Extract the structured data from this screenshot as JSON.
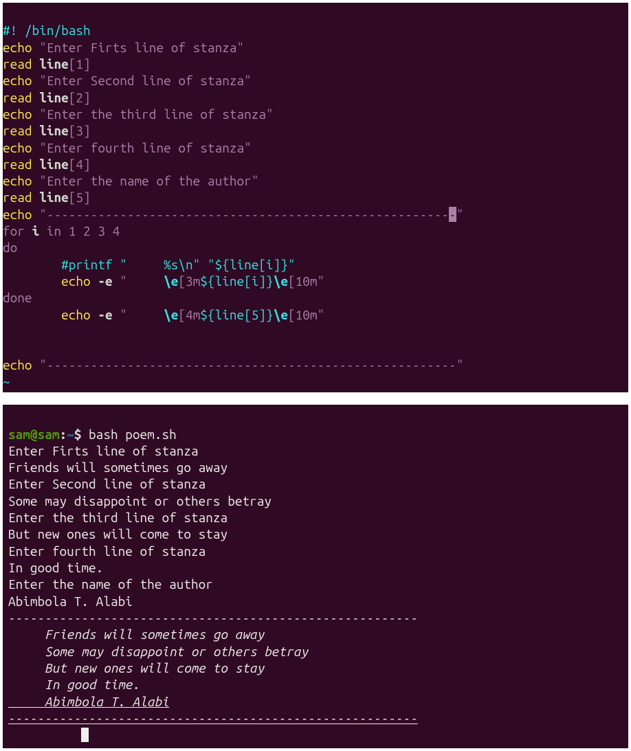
{
  "editor": {
    "l1": {
      "shebang": "#! /bin/bash"
    },
    "l2": {
      "cmd": "echo",
      "str": "\"Enter Firts line of stanza\""
    },
    "l3": {
      "cmd": "read",
      "var": "line",
      "idx": "[1]"
    },
    "l4": {
      "cmd": "echo",
      "str": "\"Enter Second line of stanza\""
    },
    "l5": {
      "cmd": "read",
      "var": "line",
      "idx": "[2]"
    },
    "l6": {
      "cmd": "echo",
      "str": "\"Enter the third line of stanza\""
    },
    "l7": {
      "cmd": "read",
      "var": "line",
      "idx": "[3]"
    },
    "l8": {
      "cmd": "echo",
      "str": "\"Enter fourth line of stanza\""
    },
    "l9": {
      "cmd": "read",
      "var": "line",
      "idx": "[4]"
    },
    "l10": {
      "cmd": "echo",
      "str": "\"Enter the name of the author\""
    },
    "l11": {
      "cmd": "read",
      "var": "line",
      "idx": "[5]"
    },
    "l12": {
      "cmd": "echo",
      "q1": "\"",
      "dashes": "-------------------------------------------------------",
      "cur": "-",
      "q2": "\""
    },
    "l13": {
      "for": "for",
      "var": "i",
      "in": "in",
      "nums": "1 2 3 4"
    },
    "l14": {
      "do": "do"
    },
    "l15": {
      "indent": "        ",
      "comment": "#printf \"     %s\\n\" \"${line[i]}\""
    },
    "l16": {
      "indent": "        ",
      "cmd": "echo",
      "flag": " -e ",
      "q": "\"",
      "pad": "     ",
      "e1": "\\e",
      "b1": "[",
      "n1": "3",
      "m1": "m",
      "v": "${line[i]}",
      "e2": "\\e",
      "b2": "[",
      "n2": "10",
      "m2": "m",
      "q2": "\""
    },
    "l17": {
      "done": "done"
    },
    "l18": {
      "indent": "        ",
      "cmd": "echo",
      "flag": " -e ",
      "q": "\"",
      "pad": "     ",
      "e1": "\\e",
      "b1": "[",
      "n1": "4",
      "m1": "m",
      "v": "${line[5]}",
      "e2": "\\e",
      "b2": "[",
      "n2": "10",
      "m2": "m",
      "q2": "\""
    },
    "l19": {
      "blank": " "
    },
    "l20": {
      "blank": " "
    },
    "l21": {
      "cmd": "echo",
      "q1": "\"",
      "dashes": "--------------------------------------------------------",
      "q2": "\""
    },
    "l22": {
      "tilde": "~"
    }
  },
  "output": {
    "prompt": {
      "user": "sam",
      "at": "@",
      "host": "sam",
      "colon": ":",
      "path": "~",
      "dollar": "$ "
    },
    "command": "bash poem.sh",
    "lines": [
      "Enter Firts line of stanza",
      "Friends will sometimes go away",
      "Enter Second line of stanza",
      "Some may disappoint or others betray",
      "Enter the third line of stanza",
      "But new ones will come to stay",
      "Enter fourth line of stanza",
      "In good time.",
      "Enter the name of the author",
      "Abimbola T. Alabi"
    ],
    "sep1": "--------------------------------------------------------",
    "poem": [
      "     Friends will sometimes go away",
      "     Some may disappoint or others betray",
      "     But new ones will come to stay",
      "     In good time."
    ],
    "author": "     Abimbola T. Alabi",
    "sep2": "--------------------------------------------------------"
  }
}
